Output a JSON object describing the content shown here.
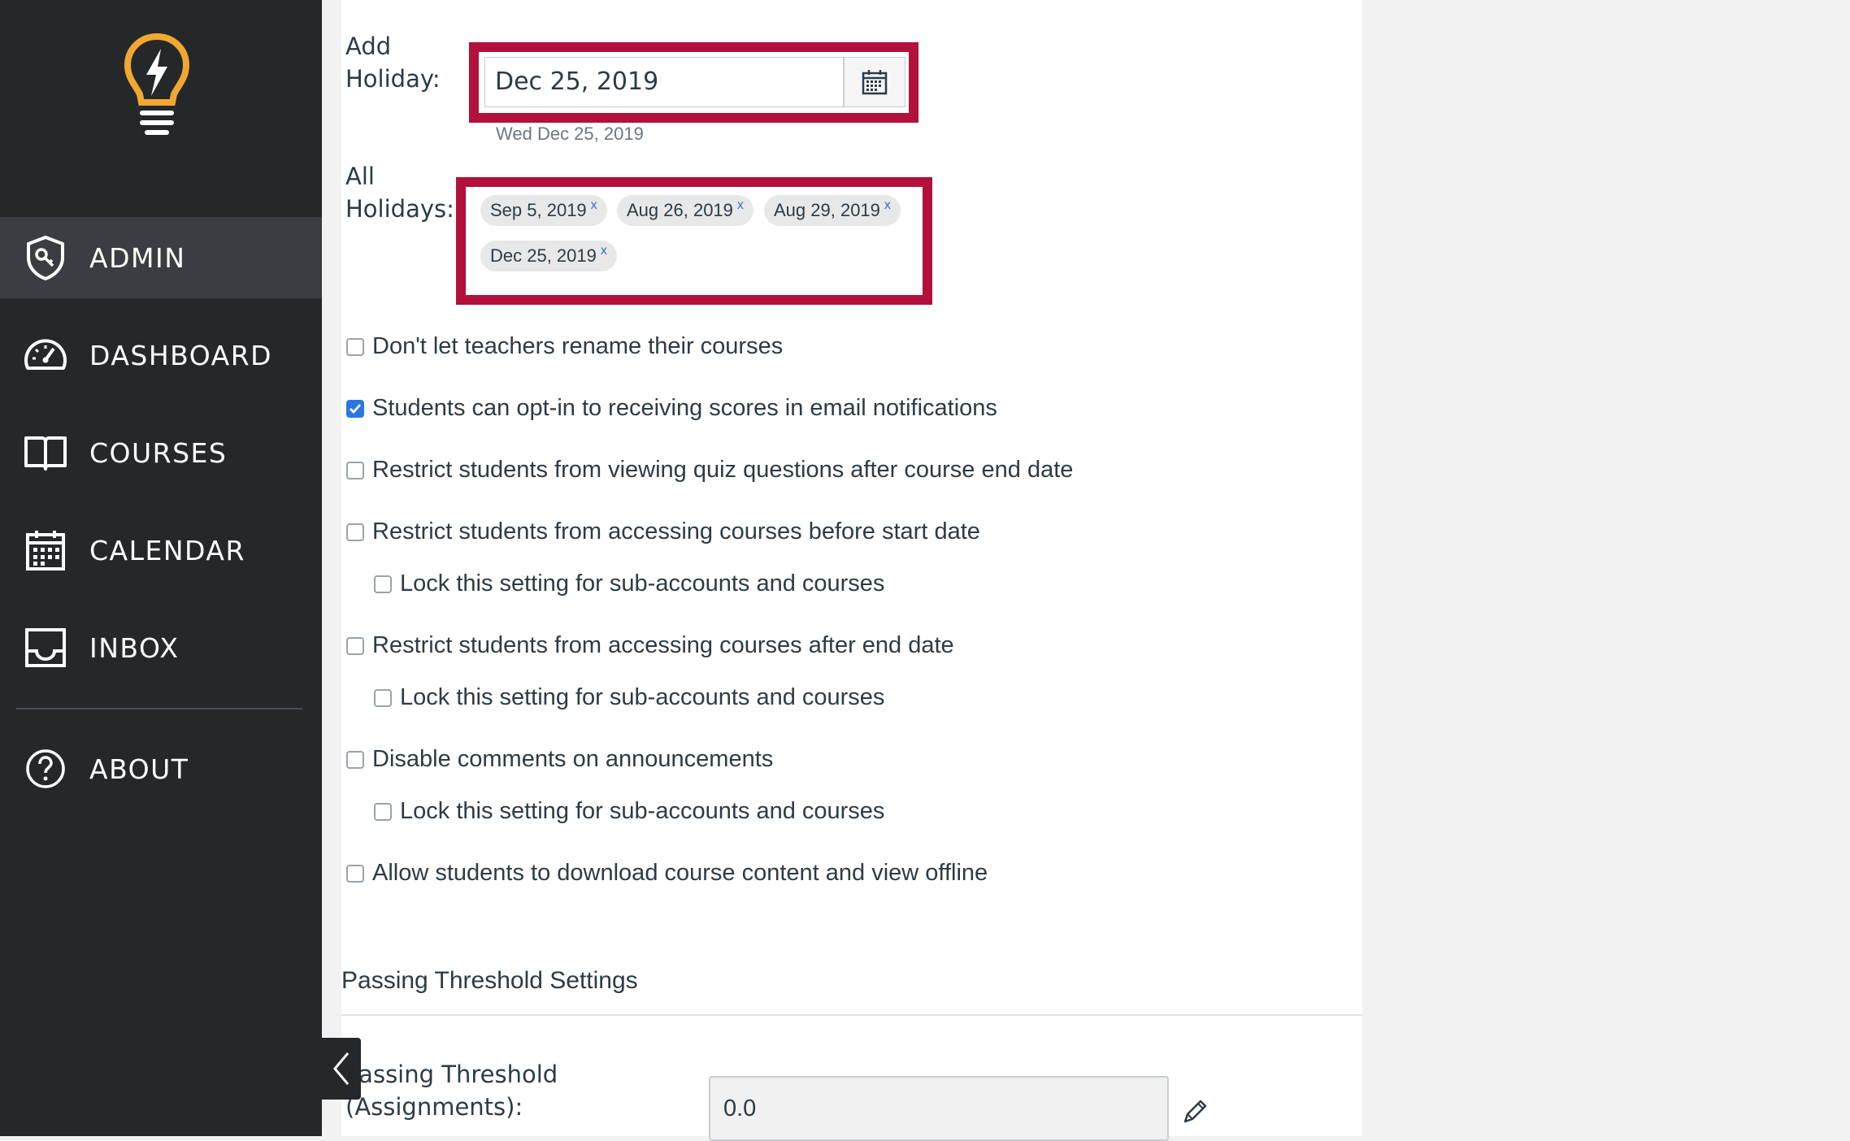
{
  "sidebar": {
    "items": [
      {
        "label": "ADMIN",
        "icon": "admin-shield-icon",
        "active": true
      },
      {
        "label": "DASHBOARD",
        "icon": "dashboard-gauge-icon",
        "active": false
      },
      {
        "label": "COURSES",
        "icon": "book-icon",
        "active": false
      },
      {
        "label": "CALENDAR",
        "icon": "calendar-icon",
        "active": false
      },
      {
        "label": "INBOX",
        "icon": "inbox-tray-icon",
        "active": false
      },
      {
        "label": "ABOUT",
        "icon": "question-circle-icon",
        "active": false
      }
    ],
    "logo_icon": "lightbulb-logo-icon",
    "collapse_icon": "chevron-left-icon"
  },
  "holidays": {
    "add_label_line1": "Add",
    "add_label_line2": "Holiday:",
    "date_value": "Dec 25, 2019",
    "date_hint": "Wed Dec 25, 2019",
    "all_label_line1": "All",
    "all_label_line2": "Holidays:",
    "chips": [
      "Sep 5, 2019",
      "Aug 26, 2019",
      "Aug 29, 2019",
      "Dec 25, 2019"
    ],
    "chip_remove": "x"
  },
  "settings": [
    {
      "label": "Don't let teachers rename their courses",
      "checked": false
    },
    {
      "label": "Students can opt-in to receiving scores in email notifications",
      "checked": true
    },
    {
      "label": "Restrict students from viewing quiz questions after course end date",
      "checked": false
    },
    {
      "label": "Restrict students from accessing courses before start date",
      "checked": false
    },
    {
      "label": "Lock this setting for sub-accounts and courses",
      "checked": false
    },
    {
      "label": "Restrict students from accessing courses after end date",
      "checked": false
    },
    {
      "label": "Lock this setting for sub-accounts and courses",
      "checked": false
    },
    {
      "label": "Disable comments on announcements",
      "checked": false
    },
    {
      "label": "Lock this setting for sub-accounts and courses",
      "checked": false
    },
    {
      "label": "Allow students to download course content and view offline",
      "checked": false
    }
  ],
  "threshold": {
    "heading": "Passing Threshold Settings",
    "label_line1": "Passing Threshold",
    "label_line2": "(Assignments):",
    "value": "0.0"
  },
  "colors": {
    "sidebar_bg": "#25282b",
    "highlight_border": "#b3103c",
    "checkbox_accent": "#2b76e5",
    "logo": "#f0a830"
  }
}
